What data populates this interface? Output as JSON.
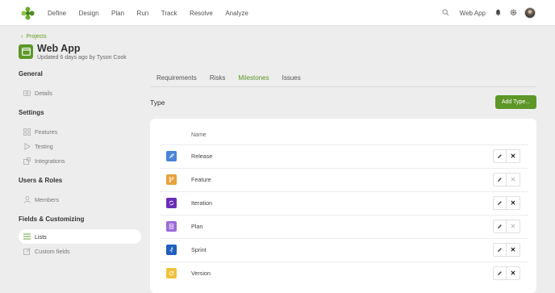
{
  "nav": {
    "items": [
      "Define",
      "Design",
      "Plan",
      "Run",
      "Track",
      "Resolve",
      "Analyze"
    ]
  },
  "top_right": {
    "app_switch": "Web App"
  },
  "breadcrumb": {
    "label": "Projects"
  },
  "project": {
    "title": "Web App",
    "subtitle": "Updated 6 days ago by Tyson Cook"
  },
  "sidebar": {
    "groups": [
      {
        "heading": "General",
        "items": [
          {
            "label": "Details",
            "icon": "camera-icon"
          }
        ]
      },
      {
        "heading": "Settings",
        "items": [
          {
            "label": "Features",
            "icon": "grid-icon"
          },
          {
            "label": "Testing",
            "icon": "play-icon"
          },
          {
            "label": "Integrations",
            "icon": "puzzle-icon"
          }
        ]
      },
      {
        "heading": "Users & Roles",
        "items": [
          {
            "label": "Members",
            "icon": "user-icon"
          }
        ]
      },
      {
        "heading": "Fields & Customizing",
        "items": [
          {
            "label": "Lists",
            "icon": "list-icon",
            "active": true
          },
          {
            "label": "Custom fields",
            "icon": "edit-box-icon"
          }
        ]
      }
    ]
  },
  "tabs": [
    {
      "label": "Requirements",
      "active": false
    },
    {
      "label": "Risks",
      "active": false
    },
    {
      "label": "Milestones",
      "active": true
    },
    {
      "label": "Issues",
      "active": false
    }
  ],
  "section": {
    "title": "Type",
    "add_button": "Add Type..."
  },
  "table": {
    "column_name": "Name",
    "rows": [
      {
        "name": "Release",
        "color": "#4a84d6",
        "icon": "rocket-icon",
        "deletable": true
      },
      {
        "name": "Feature",
        "color": "#e8a13a",
        "icon": "branch-icon",
        "deletable": false
      },
      {
        "name": "Iteration",
        "color": "#6a2fb8",
        "icon": "cycle-icon",
        "deletable": true
      },
      {
        "name": "Plan",
        "color": "#9b6bd9",
        "icon": "document-icon",
        "deletable": false
      },
      {
        "name": "Sprint",
        "color": "#1f5fbf",
        "icon": "runner-icon",
        "deletable": true
      },
      {
        "name": "Version",
        "color": "#f0c23a",
        "icon": "refresh-icon",
        "deletable": true
      }
    ]
  },
  "colors": {
    "accent": "#5d9728",
    "background": "#ededed"
  }
}
